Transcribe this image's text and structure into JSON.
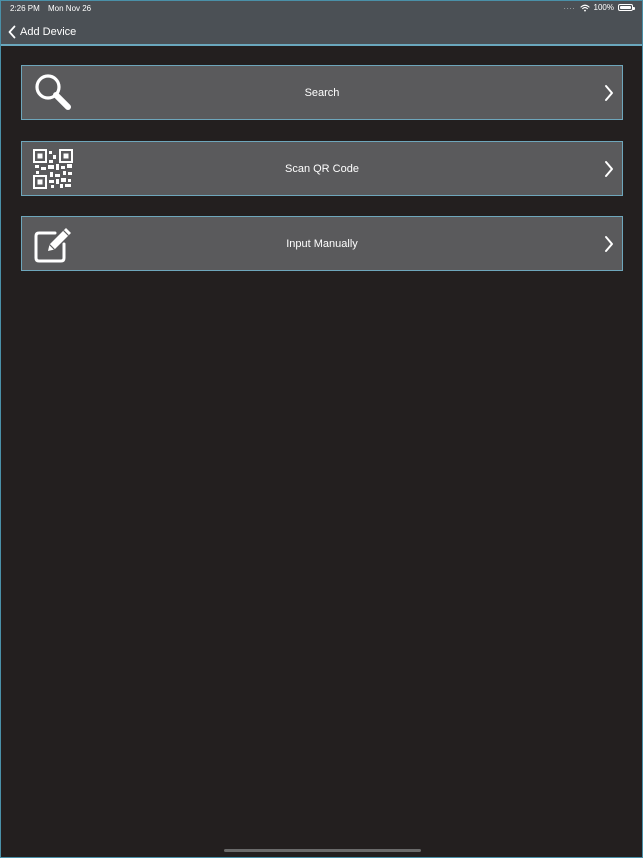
{
  "status_bar": {
    "time": "2:26 PM",
    "date": "Mon Nov 26",
    "signal": "....",
    "battery": "100%"
  },
  "nav": {
    "back_label": "Add Device"
  },
  "menu": {
    "items": [
      {
        "label": "Search",
        "icon": "search-icon"
      },
      {
        "label": "Scan QR Code",
        "icon": "qr-code-icon"
      },
      {
        "label": "Input Manually",
        "icon": "edit-icon"
      }
    ]
  },
  "colors": {
    "background": "#231f1f",
    "topbar": "#4b5055",
    "item_background": "#5a5a5c",
    "accent_border": "#6ea6bb",
    "text": "#ffffff"
  }
}
